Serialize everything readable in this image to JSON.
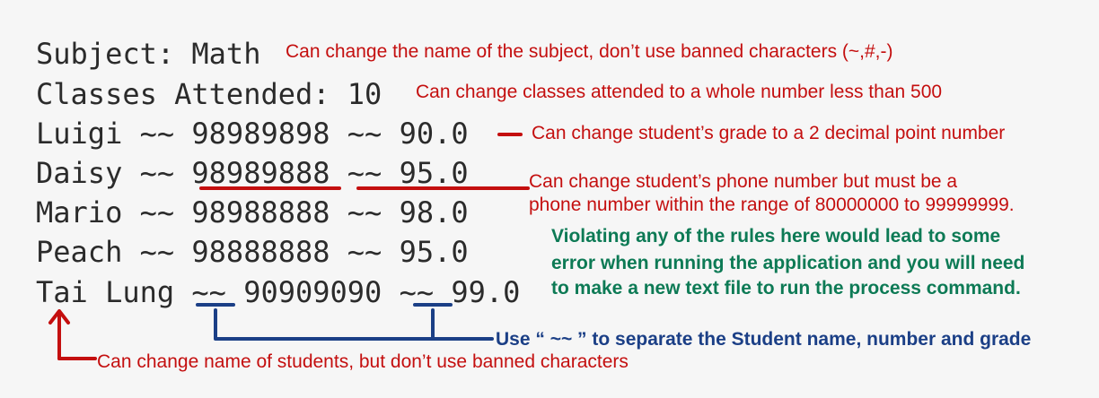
{
  "file_content": {
    "subject_line": "Subject: Math",
    "classes_line": "Classes Attended: 10",
    "students": [
      {
        "line": "Luigi ~~ 98989898 ~~ 90.0"
      },
      {
        "line": "Daisy ~~ 98989888 ~~ 95.0"
      },
      {
        "line": "Mario ~~ 98988888 ~~ 98.0"
      },
      {
        "line": "Peach ~~ 98888888 ~~ 95.0"
      },
      {
        "line": "Tai Lung ~~ 90909090 ~~ 99.0"
      }
    ]
  },
  "annotations": {
    "subject_note": "Can change the name of the subject, don’t use banned characters (~,#,-)",
    "classes_note": "Can change classes attended to a whole number less than 500",
    "grade_note": "Can change student’s grade to a 2 decimal point number",
    "phone_note_line1": "Can change student’s phone number but must be a",
    "phone_note_line2": "phone number within the range of 80000000 to 99999999.",
    "warning_line1": "Violating any of the rules here would lead to some",
    "warning_line2": "error when running the application and you will need",
    "warning_line3": "to make a new text file to run the process command.",
    "separator_note": "Use “ ~~ ” to separate the Student name, number and grade",
    "name_note": "Can change name of students, but don’t use banned characters"
  },
  "colors": {
    "background": "#f6f6f6",
    "text": "#2b2b2b",
    "red": "#c40f0f",
    "blue": "#1b3f86",
    "green": "#0d7a55"
  }
}
